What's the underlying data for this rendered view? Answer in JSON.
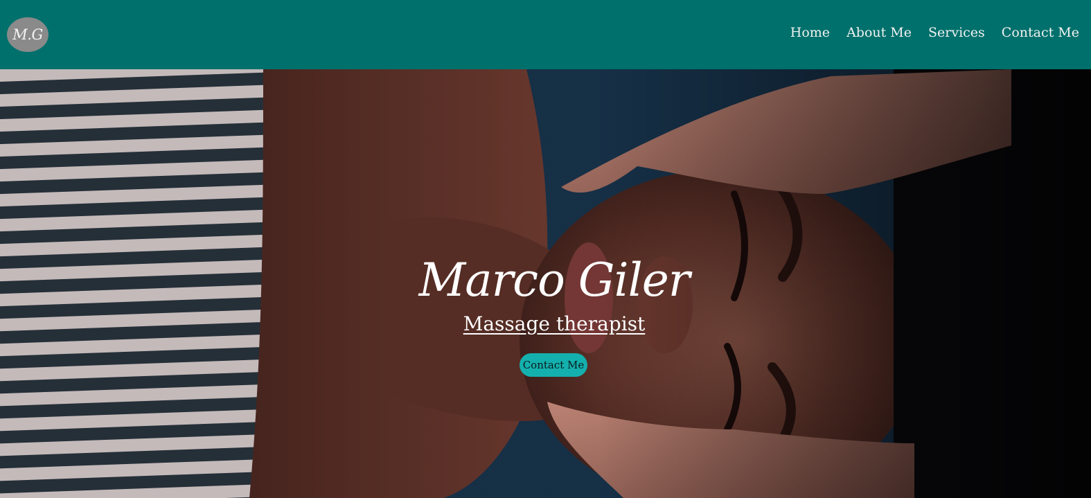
{
  "header": {
    "logo_text": "M.G",
    "nav": [
      {
        "label": "Home"
      },
      {
        "label": "About Me"
      },
      {
        "label": "Services"
      },
      {
        "label": "Contact Me"
      }
    ]
  },
  "hero": {
    "background_image": "massage-therapy-photo",
    "title": "Marco Giler",
    "subtitle": "Massage therapist",
    "cta_label": "Contact Me"
  },
  "colors": {
    "header_bg": "#00706c",
    "logo_bg": "#8a8a8a",
    "cta_bg": "#14b0ad",
    "text_light": "#ffffff"
  }
}
